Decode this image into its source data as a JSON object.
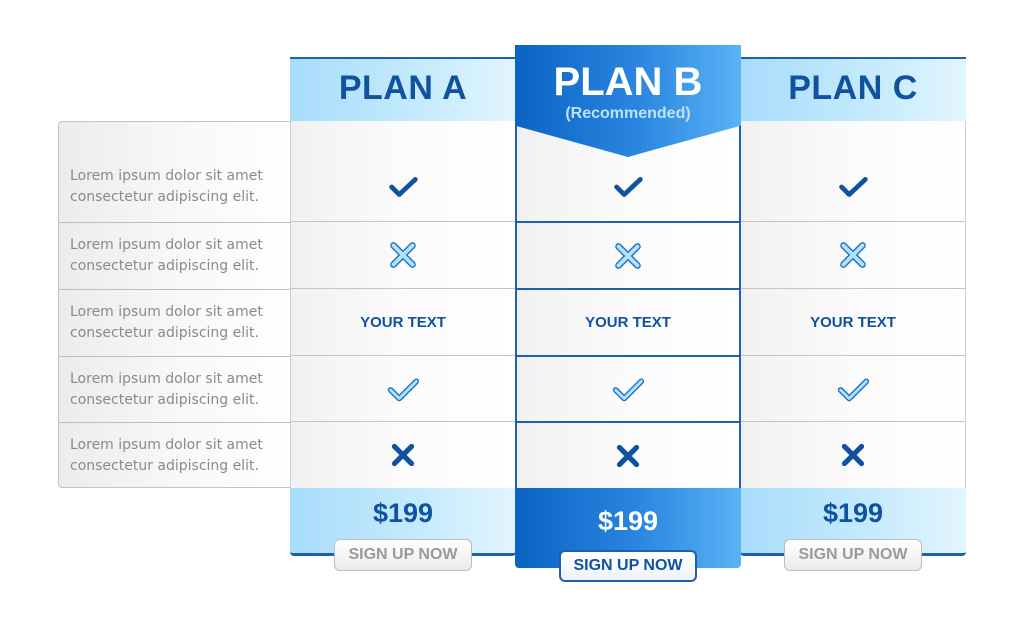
{
  "features": [
    {
      "line1": "Lorem ipsum dolor sit amet",
      "line2": "consectetur adipiscing elit."
    },
    {
      "line1": "Lorem ipsum dolor sit amet",
      "line2": "consectetur adipiscing elit."
    },
    {
      "line1": "Lorem ipsum dolor sit amet",
      "line2": "consectetur adipiscing elit."
    },
    {
      "line1": "Lorem ipsum dolor sit amet",
      "line2": "consectetur adipiscing elit."
    },
    {
      "line1": "Lorem ipsum dolor sit amet",
      "line2": "consectetur adipiscing elit."
    }
  ],
  "cell_icons": [
    "check-dark-icon",
    "cross-light-icon",
    "text",
    "check-light-icon",
    "cross-dark-icon"
  ],
  "cell_text": "YOUR TEXT",
  "plans": [
    {
      "name": "PLAN A",
      "price": "$199",
      "cta": "SIGN UP NOW",
      "recommended": false
    },
    {
      "name": "PLAN B",
      "subtitle": "(Recommended)",
      "price": "$199",
      "cta": "SIGN UP NOW",
      "recommended": true
    },
    {
      "name": "PLAN C",
      "price": "$199",
      "cta": "SIGN UP NOW",
      "recommended": false
    }
  ],
  "colors": {
    "primary": "#1152a0",
    "accent": "#2a86e0",
    "light": "#c7ebfd",
    "muted_text": "#8a8a8a"
  }
}
